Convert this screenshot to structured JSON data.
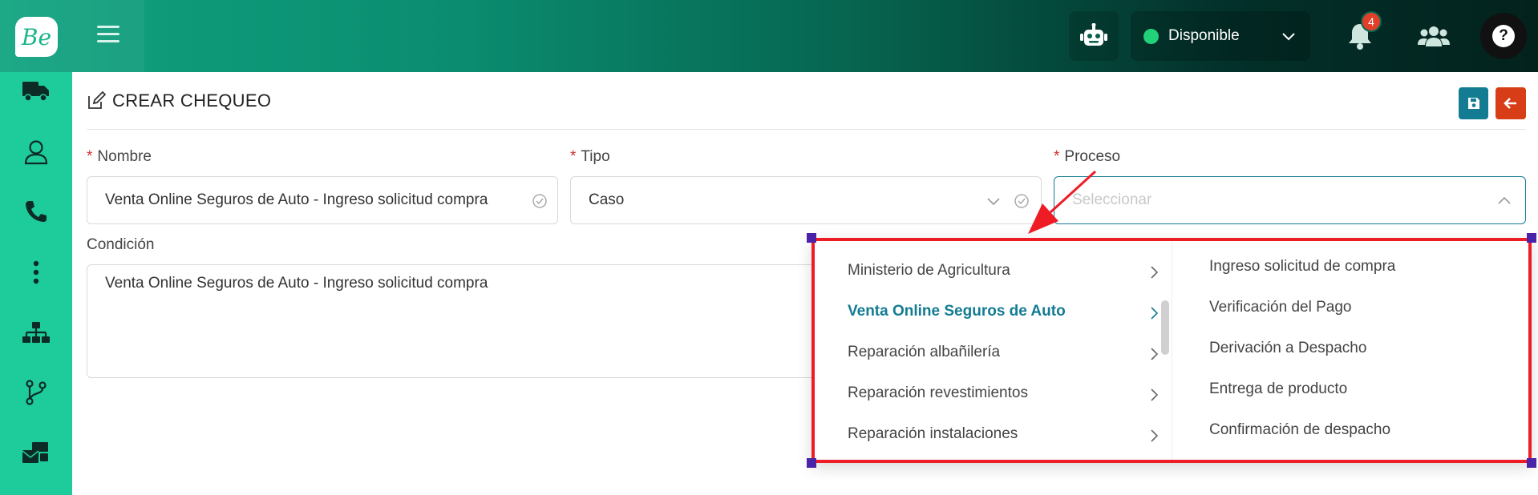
{
  "header": {
    "logo_text": "Be",
    "status_label": "Disponible",
    "status_color": "#22d27a",
    "notifications_count": "4",
    "help_label": "?",
    "icons": [
      "menu-icon",
      "robot-icon",
      "chevron-down-icon",
      "bell-icon",
      "users-icon",
      "help-icon"
    ]
  },
  "sidebar": {
    "items": [
      {
        "name": "truck-icon"
      },
      {
        "name": "user-icon"
      },
      {
        "name": "phone-icon"
      },
      {
        "name": "more-vertical-icon"
      },
      {
        "name": "sitemap-icon"
      },
      {
        "name": "git-branch-icon"
      },
      {
        "name": "mail-bulk-icon"
      }
    ]
  },
  "page": {
    "title": "CREAR CHEQUEO",
    "save_icon": "save-icon",
    "back_icon": "arrow-left-icon"
  },
  "form": {
    "required_mark": "*",
    "nombre_label": "Nombre",
    "nombre_value": "Venta Online Seguros de Auto - Ingreso solicitud compra",
    "tipo_label": "Tipo",
    "tipo_value": "Caso",
    "proceso_label": "Proceso",
    "proceso_placeholder": "Seleccionar",
    "condicion_label": "Condición",
    "condicion_value": "Venta Online Seguros de Auto - Ingreso solicitud compra"
  },
  "cascader": {
    "level1": [
      {
        "label": "Ministerio de Agricultura",
        "active": false
      },
      {
        "label": "Venta Online Seguros de Auto",
        "active": true
      },
      {
        "label": "Reparación albañilería",
        "active": false
      },
      {
        "label": "Reparación revestimientos",
        "active": false
      },
      {
        "label": "Reparación instalaciones",
        "active": false
      }
    ],
    "level2": [
      "Ingreso solicitud de compra",
      "Verificación del Pago",
      "Derivación a Despacho",
      "Entrega de producto",
      "Confirmación de despacho"
    ],
    "active_color": "#137b92"
  },
  "colors": {
    "accent_green": "#1ecb9a",
    "save_button": "#137b92",
    "back_button": "#d73d16",
    "annotation_red": "#ee1c25"
  }
}
